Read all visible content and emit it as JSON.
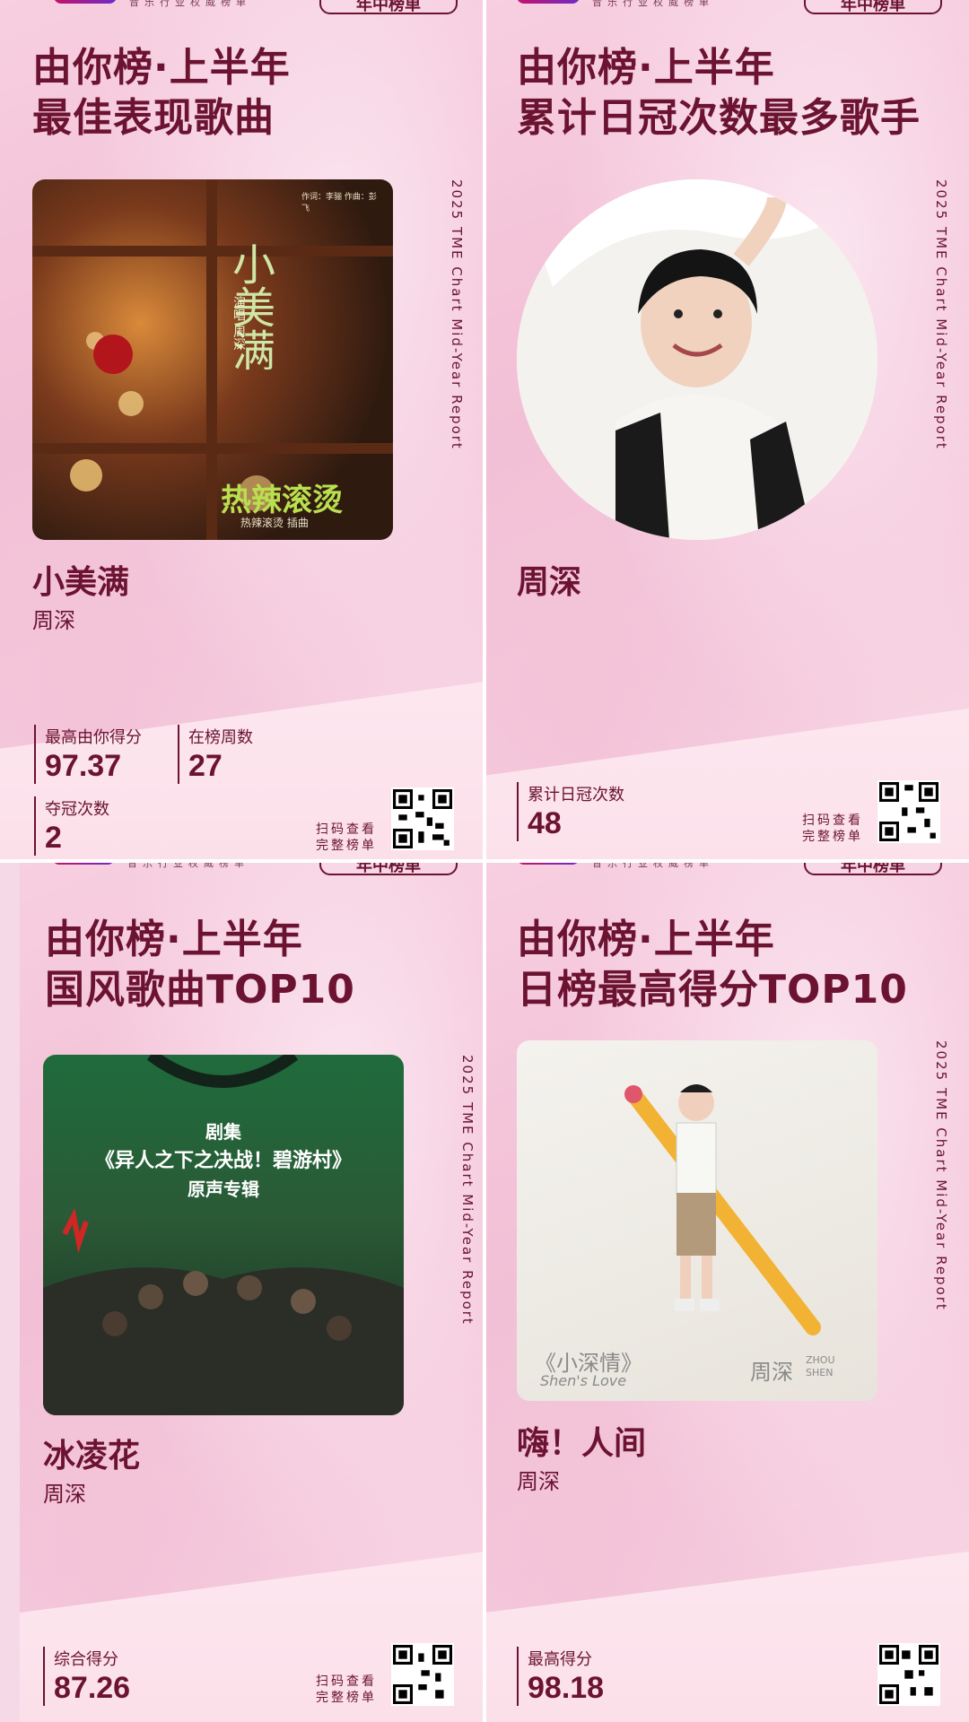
{
  "common": {
    "header_title": "由你榜·上半年",
    "vertical_label": "2025 TME Chart Mid-Year Report",
    "scan_line1": "扫码查看",
    "scan_line2": "完整榜单",
    "logo_sub": "音乐行业权威榜单",
    "logo_tag": "年中榜单"
  },
  "cards": [
    {
      "subtitle": "最佳表现歌曲",
      "song": "小美满",
      "artist": "周深",
      "art_text": {
        "title": "小美满",
        "credit1": "演唱 周深",
        "credit2": "作词：李骊 作曲：彭飞",
        "film": "热辣滚烫",
        "film_sub": "热辣滚烫 插曲"
      },
      "stats": [
        {
          "label": "最高由你得分",
          "value": "97.37"
        },
        {
          "label": "在榜周数",
          "value": "27"
        },
        {
          "label": "夺冠次数",
          "value": "2"
        }
      ]
    },
    {
      "subtitle": "累计日冠次数最多歌手",
      "song": "周深",
      "stats": [
        {
          "label": "累计日冠次数",
          "value": "48"
        }
      ]
    },
    {
      "subtitle": "国风歌曲TOP10",
      "song": "冰凌花",
      "artist": "周深",
      "art_text": {
        "line1": "剧集",
        "line2": "《异人之下之决战！碧游村》",
        "line3": "原声专辑"
      },
      "stats": [
        {
          "label": "综合得分",
          "value": "87.26"
        }
      ]
    },
    {
      "subtitle": "日榜最高得分TOP10",
      "song": "嗨！人间",
      "artist": "周深",
      "art_text": {
        "album": "《小深情》",
        "album_en": "Shen's Love",
        "name": "周深",
        "name_en": "ZHOU SHEN"
      },
      "stats": [
        {
          "label": "最高得分",
          "value": "98.18"
        }
      ]
    }
  ],
  "colors": {
    "text": "#6b1330",
    "bg": "#f6d9e6",
    "accent": "#c4126b"
  }
}
